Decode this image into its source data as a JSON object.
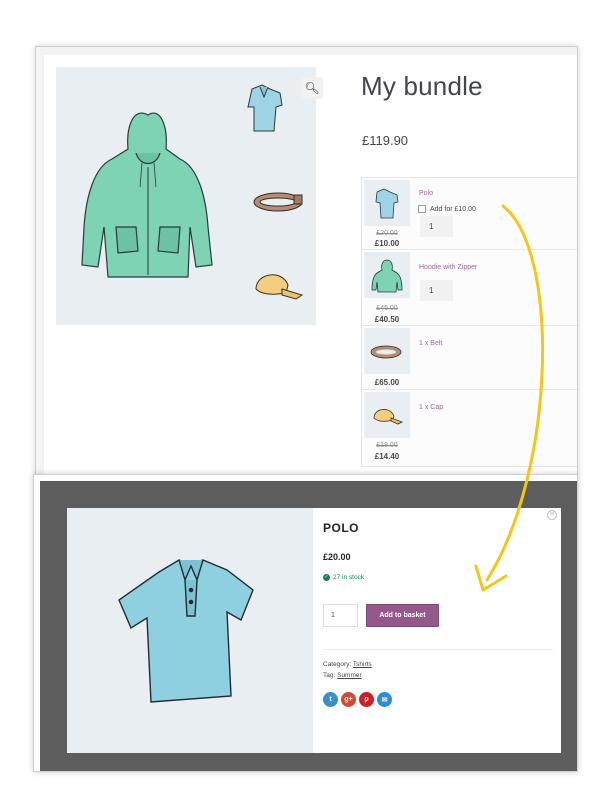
{
  "top_window": {
    "product_title": "My bundle",
    "product_price": "£119.90",
    "zoom_icon": "magnifier-plus-icon",
    "gallery_items": [
      "hoodie",
      "polo",
      "belt",
      "cap"
    ],
    "bundle_items": [
      {
        "name": "Polo",
        "old_price": "£20.00",
        "price": "£10.00",
        "quantity": "1",
        "checkbox_label": "Add for £10.00",
        "checked": false
      },
      {
        "name": "Hoodie with Zipper",
        "old_price": "£45.00",
        "price": "£40.50",
        "quantity": "1"
      },
      {
        "name": "1 x Belt",
        "old_price": "",
        "price": "£65.00"
      },
      {
        "name": "1 x Cap",
        "old_price": "£18.00",
        "price": "£14.40"
      }
    ]
  },
  "quick_view": {
    "title": "POLO",
    "price": "£20.00",
    "stock": "27 in stock",
    "quantity": "1",
    "add_button": "Add to basket",
    "category_label": "Category:",
    "category_value": "Tshirts",
    "tag_label": "Tag:",
    "tag_value": "Summer",
    "close_icon": "close-icon",
    "share_icons": [
      {
        "name": "twitter-icon",
        "glyph": "t",
        "color": "#3b8ed1"
      },
      {
        "name": "google-plus-icon",
        "glyph": "g+",
        "color": "#d34836"
      },
      {
        "name": "pinterest-icon",
        "glyph": "p",
        "color": "#cb2027"
      },
      {
        "name": "email-icon",
        "glyph": "✉",
        "color": "#2c8ed6"
      }
    ]
  },
  "colors": {
    "accent_purple": "#96588a",
    "link_purple": "#a46497",
    "arrow_yellow": "#f5c518",
    "stock_green": "#0f834d",
    "image_bg": "#e8eef1"
  }
}
